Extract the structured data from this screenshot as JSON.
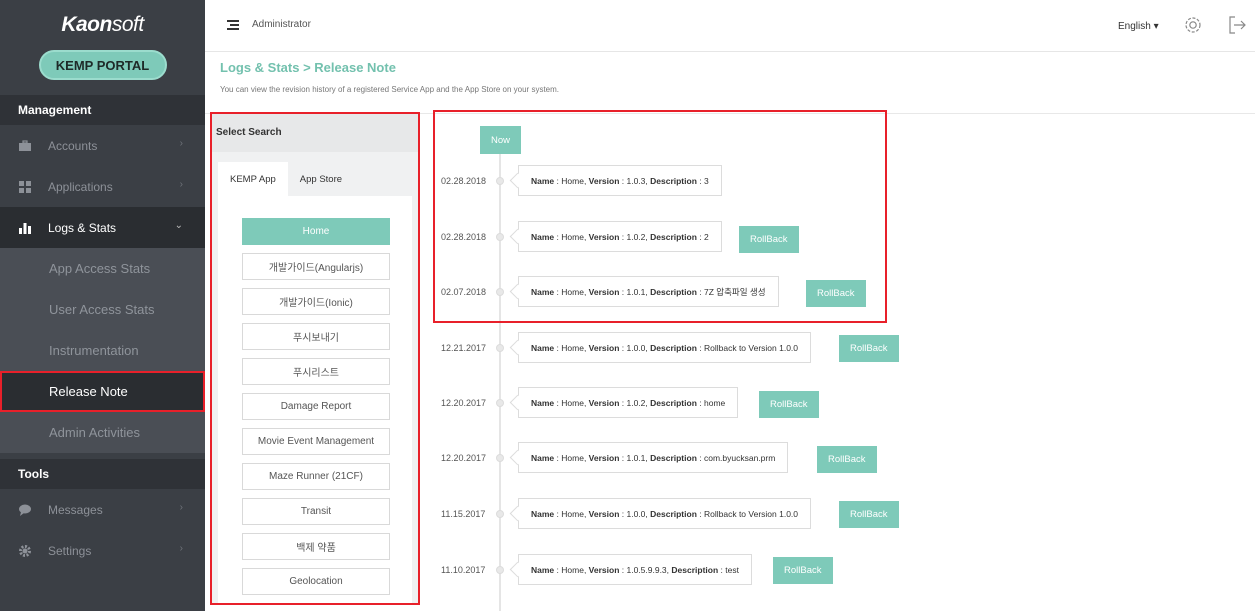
{
  "brand": {
    "logo_bold": "Kaon",
    "logo_rest": "soft",
    "portal": "KEMP PORTAL"
  },
  "sidebar": {
    "section_management": "Management",
    "items": [
      {
        "label": "Accounts",
        "icon": "briefcase-icon"
      },
      {
        "label": "Applications",
        "icon": "grid-icon"
      },
      {
        "label": "Logs & Stats",
        "icon": "bar-chart-icon"
      }
    ],
    "logs_sub": [
      "App Access Stats",
      "User Access Stats",
      "Instrumentation",
      "Release Note",
      "Admin Activities"
    ],
    "section_tools": "Tools",
    "tools": [
      {
        "label": "Messages",
        "icon": "chat-bubble-icon"
      },
      {
        "label": "Settings",
        "icon": "gear-icon"
      }
    ]
  },
  "topbar": {
    "user": "Administrator",
    "language": "English ▾"
  },
  "page": {
    "title": "Logs & Stats > Release Note",
    "description": "You can view the revision history of a registered Service App and the App Store on your system."
  },
  "search": {
    "title": "Select Search",
    "tabs": [
      "KEMP App",
      "App Store"
    ],
    "apps": [
      "Home",
      "개발가이드(Angularjs)",
      "개발가이드(Ionic)",
      "푸시보내기",
      "푸시리스트",
      "Damage Report",
      "Movie Event Management",
      "Maze Runner (21CF)",
      "Transit",
      "백제 약품",
      "Geolocation"
    ]
  },
  "timeline": {
    "now_label": "Now",
    "name_label": "Name",
    "version_label": "Version",
    "description_label": "Description",
    "rollback_label": "RollBack",
    "entries": [
      {
        "date": "02.28.2018",
        "name": "Home",
        "version": "1.0.3",
        "description": "3"
      },
      {
        "date": "02.28.2018",
        "name": "Home",
        "version": "1.0.2",
        "description": "2"
      },
      {
        "date": "02.07.2018",
        "name": "Home",
        "version": "1.0.1",
        "description": "7Z 압축파일 생성"
      },
      {
        "date": "12.21.2017",
        "name": "Home",
        "version": "1.0.0",
        "description": "Rollback to Version 1.0.0"
      },
      {
        "date": "12.20.2017",
        "name": "Home",
        "version": "1.0.2",
        "description": "home"
      },
      {
        "date": "12.20.2017",
        "name": "Home",
        "version": "1.0.1",
        "description": "com.byucksan.prm"
      },
      {
        "date": "11.15.2017",
        "name": "Home",
        "version": "1.0.0",
        "description": "Rollback to Version 1.0.0"
      },
      {
        "date": "11.10.2017",
        "name": "Home",
        "version": "1.0.5.9.9.3",
        "description": "test"
      }
    ]
  },
  "colors": {
    "accent": "#7ecab9",
    "sidebar": "#3b3f45",
    "highlight": "#e8202a"
  }
}
